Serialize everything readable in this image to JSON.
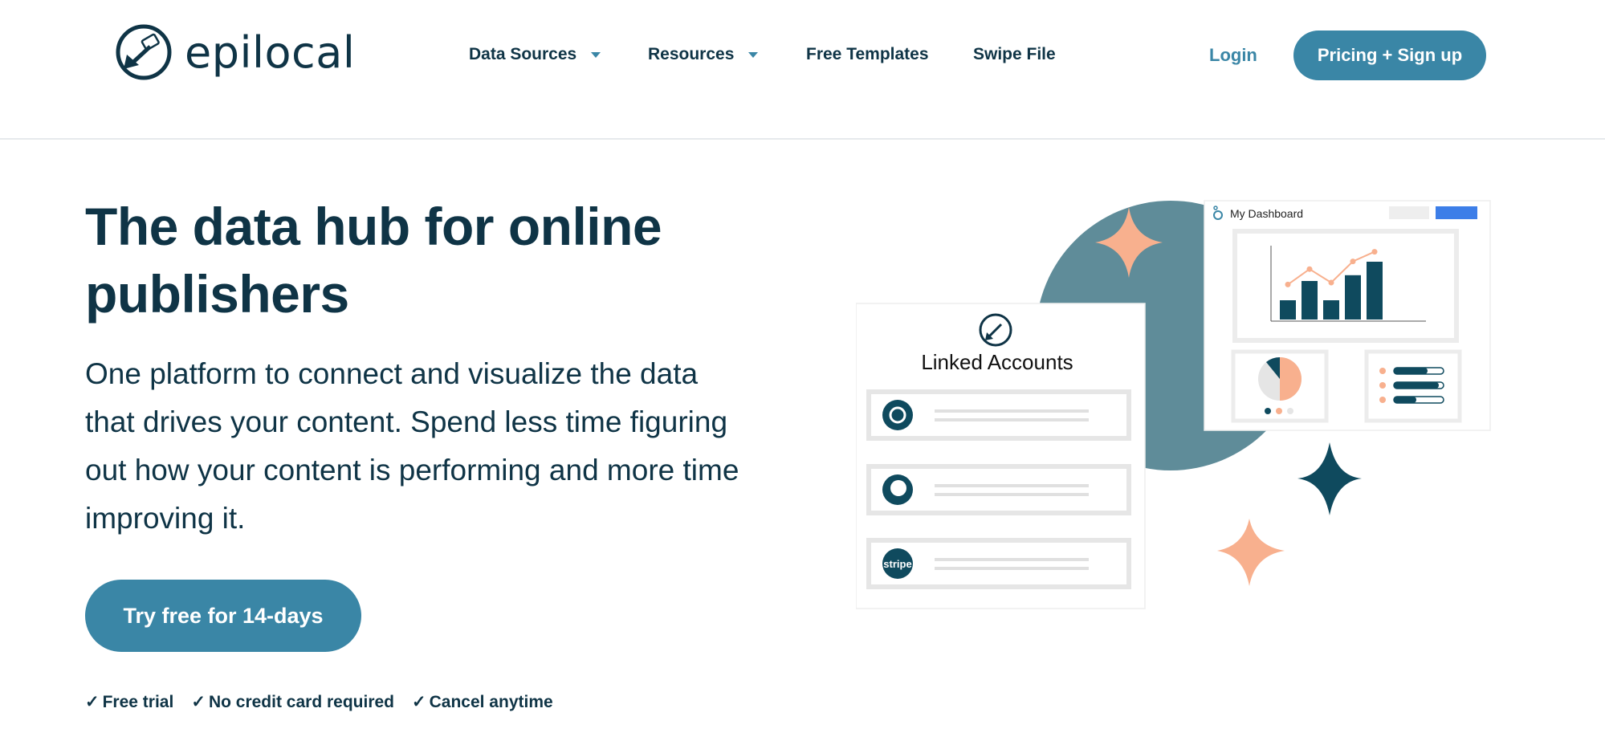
{
  "brand": {
    "name": "epilocal"
  },
  "nav": {
    "items": [
      {
        "label": "Data Sources",
        "has_dropdown": true
      },
      {
        "label": "Resources",
        "has_dropdown": true
      },
      {
        "label": "Free Templates",
        "has_dropdown": false
      },
      {
        "label": "Swipe File",
        "has_dropdown": false
      }
    ],
    "login_label": "Login",
    "signup_label": "Pricing + Sign up"
  },
  "hero": {
    "title": "The data hub for online publishers",
    "subtitle": "One platform to connect and visualize the data that drives your content. Spend less time figuring out how your content is performing and more time improving it.",
    "cta_label": "Try free for 14-days",
    "checks": [
      "Free trial",
      "No credit card required",
      "Cancel anytime"
    ]
  },
  "illustration": {
    "linked_accounts_title": "Linked Accounts",
    "dashboard_title": "My Dashboard",
    "account_icons": [
      "mailchimp-icon",
      "patreon-icon",
      "stripe-icon"
    ],
    "stripe_label": "stripe",
    "chart": {
      "bars": [
        1,
        2,
        1,
        2.3,
        3
      ],
      "line": [
        1.4,
        2.2,
        1.5,
        2.6,
        3.1
      ]
    }
  },
  "colors": {
    "primary": "#3a86a6",
    "dark": "#0f3446",
    "accent": "#f8b08e",
    "circle": "#5f8c99",
    "blue_button": "#3d7ee8"
  }
}
